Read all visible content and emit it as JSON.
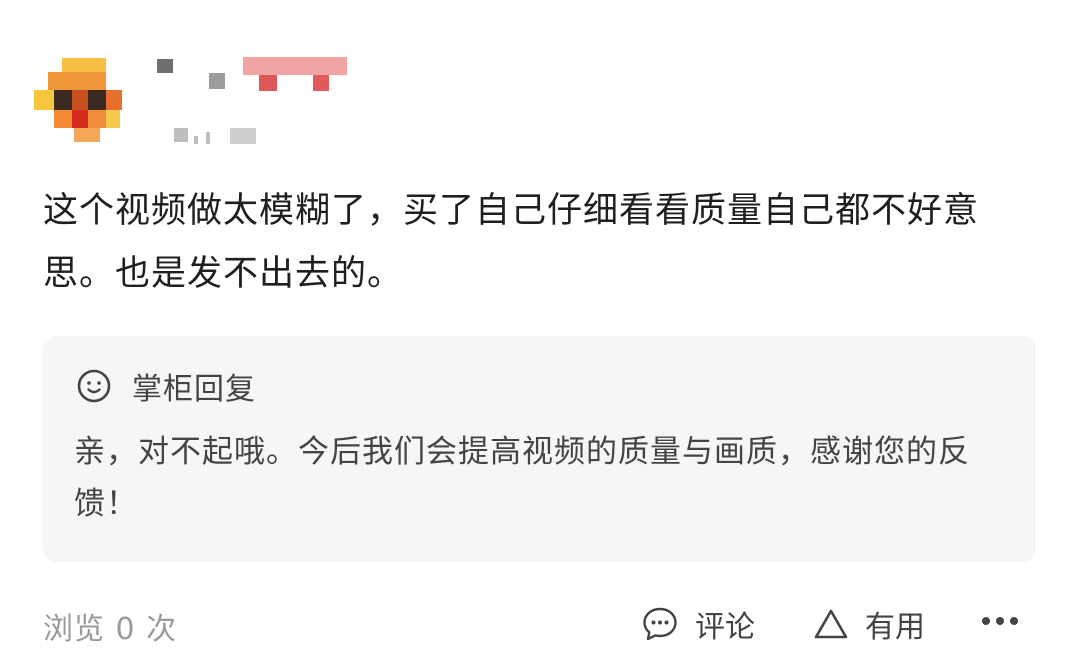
{
  "comment": {
    "text": "这个视频做太模糊了，买了自己仔细看看质量自己都不好意思。也是发不出去的。"
  },
  "reply": {
    "title": "掌柜回复",
    "text": "亲，对不起哦。今后我们会提高视频的质量与画质，感谢您的反馈！"
  },
  "footer": {
    "views": "浏览 0 次",
    "comment_label": "评论",
    "useful_label": "有用"
  },
  "icons": {
    "smile": "smile-face-icon",
    "comment": "chat-bubble-icon",
    "useful": "triangle-up-icon",
    "more": "more-dots-icon"
  },
  "colors": {
    "background": "#ffffff",
    "reply_background": "#f6f6f6",
    "primary_text": "#1f1f1f",
    "secondary_text": "#444444",
    "muted_text": "#9a9a9a"
  }
}
